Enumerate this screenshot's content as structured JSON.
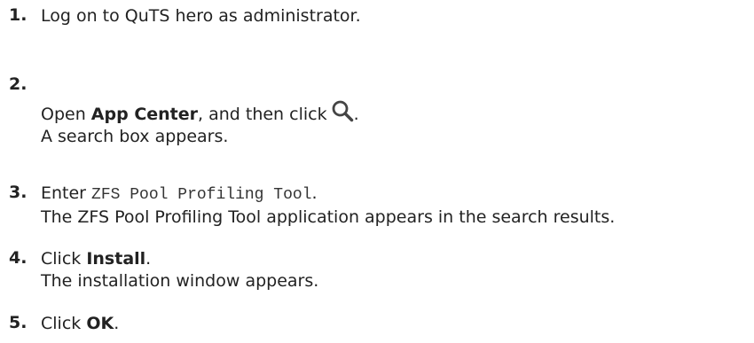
{
  "steps": [
    {
      "number": "1.",
      "text": "Log on to QuTS hero as administrator."
    },
    {
      "number": "2.",
      "text_before": "Open ",
      "bold": "App Center",
      "text_after": ", and then click",
      "icon": "search-icon",
      "text_end": ".",
      "result": "A search box appears."
    },
    {
      "number": "3.",
      "text_before": "Enter ",
      "code": "ZFS Pool Profiling Tool",
      "text_after": ".",
      "result": "The ZFS Pool Profiling Tool application appears in the search results."
    },
    {
      "number": "4.",
      "text_before": "Click ",
      "bold": "Install",
      "text_after": ".",
      "result": "The installation window appears."
    },
    {
      "number": "5.",
      "text_before": "Click ",
      "bold": "OK",
      "text_after": "."
    }
  ]
}
